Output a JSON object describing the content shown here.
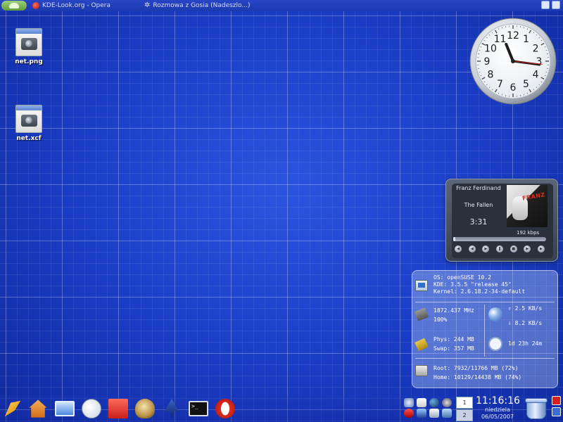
{
  "topbar": {
    "tasks": [
      {
        "label": "KDE-Look.org - Opera",
        "icon": "opera-icon"
      },
      {
        "label": "Rozmowa z Gosia (Nadeszlo...)",
        "icon": "gear-icon"
      }
    ]
  },
  "desktop": {
    "icons": [
      {
        "label": "net.png",
        "icon": "image-file-icon"
      },
      {
        "label": "net.xcf",
        "icon": "image-file-icon"
      }
    ]
  },
  "clock_widget": {
    "numbers": [
      "12",
      "1",
      "2",
      "3",
      "4",
      "5",
      "6",
      "7",
      "8",
      "9",
      "10",
      "11"
    ],
    "hour": 11,
    "minute": 16,
    "second": 16
  },
  "player": {
    "artist": "Franz Ferdinand",
    "album": "The Fallen",
    "time": "3:31",
    "bitrate": "192 kbps",
    "cover_text": "FRANZ",
    "progress": 0.02,
    "controls": [
      "prev",
      "rewind",
      "play",
      "pause",
      "stop",
      "forward",
      "next"
    ]
  },
  "sysmon": {
    "os": "OS: openSUSE 10.2",
    "kde": "KDE: 3.5.5 \"release 45\"",
    "kernel": "Kernel: 2.6.18.2-34-default",
    "cpu_freq": "1872.437 MHz",
    "cpu_load": "100%",
    "net_up": "2.5 KB/s",
    "net_down": "8.2 KB/s",
    "mem_phys": "Phys: 244 MB",
    "mem_swap": "Swap: 357 MB",
    "uptime": "1d 23h 24m",
    "disk_root": "Root: 7932/11766 MB (72%)",
    "disk_home": "Home: 10129/14438 MB (74%)"
  },
  "panel": {
    "launchers": [
      "kwrite",
      "home",
      "my-computer",
      "clock",
      "office",
      "gimp",
      "inkscape",
      "konsole",
      "opera"
    ],
    "pager": [
      "1",
      "2"
    ],
    "clock_time": "11:16:16",
    "clock_day": "niedziela",
    "clock_date": "06/05/2007"
  }
}
